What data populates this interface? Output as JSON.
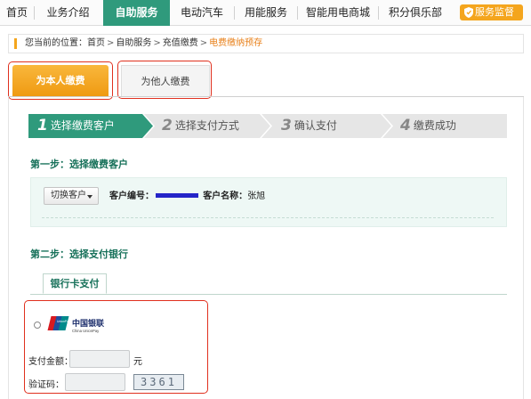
{
  "nav": {
    "items": [
      "首页",
      "业务介绍",
      "自助服务",
      "电动汽车",
      "用能服务",
      "智能用电商城",
      "积分俱乐部"
    ],
    "active_index": 2,
    "button_label": "服务监督",
    "button_icon": "shield-icon"
  },
  "breadcrumb": {
    "prefix": "您当前的位置：",
    "items": [
      "首页",
      "自助服务",
      "充值缴费"
    ],
    "current": "电费缴纳预存",
    "separator": ">"
  },
  "tabs": {
    "self": "为本人缴费",
    "other": "为他人缴费"
  },
  "steps": [
    {
      "num": "1",
      "label": "选择缴费客户",
      "active": true
    },
    {
      "num": "2",
      "label": "选择支付方式",
      "active": false
    },
    {
      "num": "3",
      "label": "确认支付",
      "active": false
    },
    {
      "num": "4",
      "label": "缴费成功",
      "active": false
    }
  ],
  "step1": {
    "title": "第一步：选择缴费客户",
    "switch_label": "切换客户",
    "customer_id_label": "客户编号：",
    "customer_name_label": "客户名称：",
    "customer_name": "张旭"
  },
  "step2": {
    "title": "第二步：选择支付银行",
    "bank_tab": "银行卡支付"
  },
  "payment": {
    "bank_logo_cn": "中国银联",
    "bank_logo_en": "China UnionPay",
    "bank_logo_badge": "UnionPay",
    "amount_label": "支付金额：",
    "amount_value": "",
    "amount_unit": "元",
    "captcha_label": "验证码：",
    "captcha_value": "",
    "captcha_text": "3361"
  },
  "colors": {
    "brand_green": "#2f9a7c",
    "title_green": "#17715a",
    "orange": "#f4a51d",
    "highlight_red": "#e0301e"
  }
}
